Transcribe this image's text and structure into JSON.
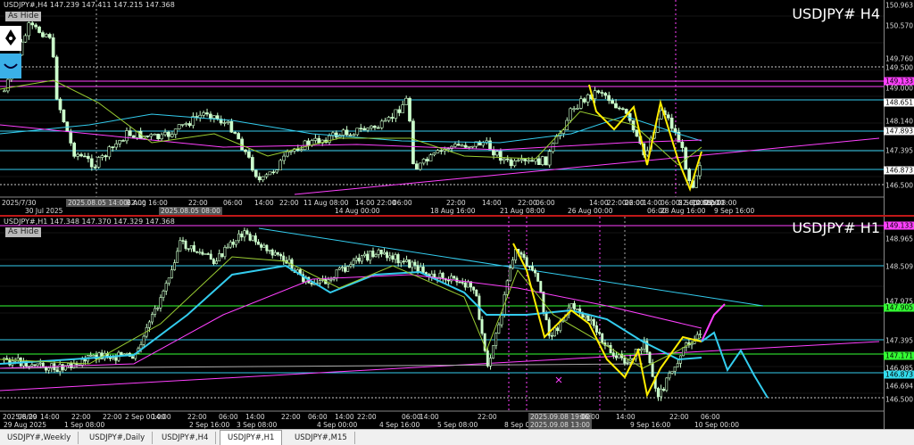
{
  "h4": {
    "header": "USDJPY#,H4  147.239 147.411 147.215 147.368",
    "symbol": "USDJPY# H4",
    "as_hide": "As Hide",
    "price_labels": [
      "150.963",
      "150.570",
      "149.760",
      "149.500",
      "149.133",
      "149.000",
      "148.651",
      "148.140",
      "147.893",
      "147.395",
      "146.873",
      "146.500"
    ],
    "tag_labels": [
      {
        "text": "149.133",
        "color": "#ff40ff"
      },
      {
        "text": "148.651",
        "color": "#ffffff"
      },
      {
        "text": "147.893",
        "color": "#ffffff"
      },
      {
        "text": "146.873",
        "color": "#ffffff"
      }
    ],
    "time_labels": [
      "2025/7/30",
      "30 Jul 2025",
      "2025.08.05 14:00",
      "22:00",
      "6 Aug 16:00",
      "2025.08.05 08:00",
      "22:00",
      "06:00",
      "14:00",
      "22:00",
      "11 Aug 08:00",
      "14 Aug 00:00",
      "14:00",
      "22:00",
      "06:00",
      "18 Aug 16:00",
      "22:00",
      "14:00",
      "21 Aug 08:00",
      "22:00",
      "06:00",
      "26 Aug 00:00",
      "14:00",
      "22:00",
      "06:00",
      "14:00",
      "28 Aug 16:00",
      "06:00",
      "22:00",
      "2 Sep 08:00",
      "22:00",
      "06:00",
      "5 Sep 00:00",
      "14:00",
      "22:00",
      "9 Sep 16:00"
    ]
  },
  "h1": {
    "header": "USDJPY#,H1  147.348 147.370 147.329 147.368",
    "symbol": "USDJPY# H1",
    "as_hide": "As Hide",
    "price_labels": [
      "149.133",
      "148.965",
      "148.509",
      "147.975",
      "147.905",
      "147.395",
      "147.171",
      "146.985",
      "146.873",
      "146.694",
      "146.500"
    ],
    "tag_labels": [
      {
        "text": "149.133",
        "color": "#ff40ff"
      },
      {
        "text": "147.905",
        "color": "#33ff33"
      },
      {
        "text": "147.171",
        "color": "#33ff33"
      },
      {
        "text": "146.873",
        "color": "#33ddee"
      }
    ],
    "time_labels": [
      "2025/8/29",
      "06:00",
      "14:00",
      "22:00",
      "29 Aug 2025",
      "1 Sep 08:00",
      "22:00",
      "2 Sep 00:00",
      "14:00",
      "22:00",
      "2 Sep 16:00",
      "06:00",
      "14:00",
      "3 Sep 08:00",
      "22:00",
      "06:00",
      "4 Sep 00:00",
      "14:00",
      "22:00",
      "4 Sep 16:00",
      "06:00",
      "14:00",
      "5 Sep 08:00",
      "22:00",
      "2025.09.08 19:00",
      "8 Sep 00:00",
      "06:00",
      "2025.09.08 13:00",
      "14:00",
      "9 Sep 16:00",
      "22:00",
      "06:00",
      "10 Sep 00:00"
    ]
  },
  "tabs": [
    "USDJPY#,Weekly",
    "USDJPY#,Daily",
    "USDJPY#,H4",
    "USDJPY#,H1",
    "USDJPY#,M15"
  ],
  "active_tab": "USDJPY#,H1",
  "colors": {
    "candle": "#ccffcc",
    "cyan_line": "#33ccee",
    "magenta": "#ff40ff",
    "yellow": "#ffee00",
    "green_hline": "#33ff33"
  }
}
